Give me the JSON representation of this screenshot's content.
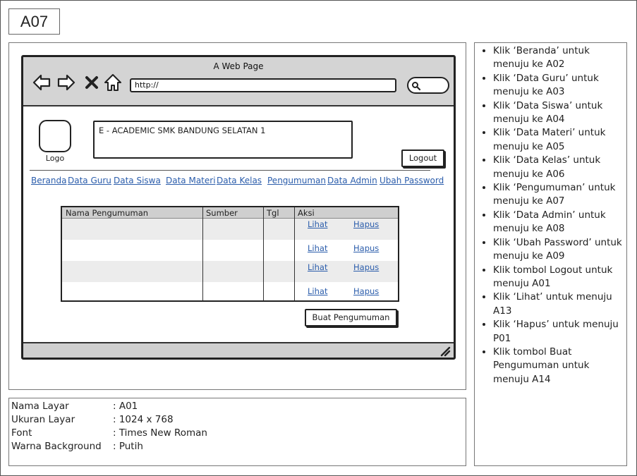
{
  "screen_id": "A07",
  "browser": {
    "window_title": "A Web Page",
    "url": "http://"
  },
  "header": {
    "logo_label": "Logo",
    "banner_text": "E - ACADEMIC SMK BANDUNG SELATAN 1",
    "logout_label": "Logout"
  },
  "menu": [
    "Beranda",
    "Data Guru",
    "Data Siswa",
    "Data Materi",
    "Data Kelas",
    "Pengumuman",
    "Data Admin",
    "Ubah Password"
  ],
  "table": {
    "columns": [
      "Nama Pengumuman",
      "Sumber",
      "Tgl",
      "Aksi"
    ],
    "rows": [
      {
        "view": "Lihat",
        "delete": "Hapus"
      },
      {
        "view": "Lihat",
        "delete": "Hapus"
      },
      {
        "view": "Lihat",
        "delete": "Hapus"
      },
      {
        "view": "Lihat",
        "delete": "Hapus"
      }
    ]
  },
  "create_button": "Buat Pengumuman",
  "info": {
    "rows": [
      {
        "key": "Nama Layar",
        "value": ": A01"
      },
      {
        "key": "Ukuran Layar",
        "value": ": 1024 x 768"
      },
      {
        "key": "Font",
        "value": ": Times New Roman"
      },
      {
        "key": "Warna Background",
        "value": ": Putih"
      }
    ]
  },
  "notes": [
    "Klik ‘Beranda’ untuk menuju ke A02",
    "Klik ‘Data Guru’ untuk menuju ke A03",
    "Klik ‘Data Siswa’ untuk menuju ke A04",
    "Klik ‘Data Materi’ untuk menuju ke A05",
    "Klik ‘Data Kelas’ untuk menuju ke A06",
    "Klik ‘Pengumuman’ untuk menuju ke A07",
    "Klik ‘Data Admin’ untuk menuju ke A08",
    "Klik ‘Ubah Password’ untuk menuju ke A09",
    "Klik tombol Logout untuk menuju A01",
    "Klik ‘Lihat’ untuk menuju A13",
    "Klik ‘Hapus’ untuk menuju P01",
    "Klik tombol Buat Pengumuman untuk menuju A14"
  ],
  "colors": {
    "link": "#2b5dab",
    "chrome_gray": "#d4d4d4",
    "table_header": "#cfcfcf",
    "row_stripe": "#ececec"
  }
}
